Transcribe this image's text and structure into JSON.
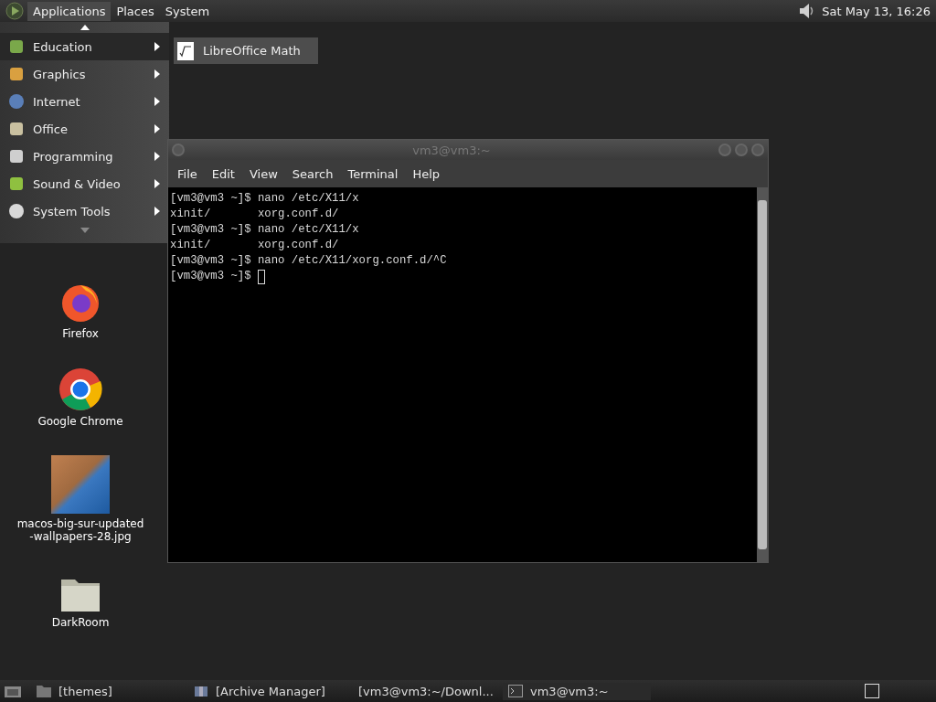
{
  "top_panel": {
    "menus": [
      {
        "label": "Applications",
        "selected": true
      },
      {
        "label": "Places",
        "selected": false
      },
      {
        "label": "System",
        "selected": false
      }
    ],
    "clock": "Sat May 13, 16:26"
  },
  "applications_menu": {
    "items": [
      {
        "label": "Education",
        "selected": true,
        "kind": "education"
      },
      {
        "label": "Graphics",
        "selected": false,
        "kind": "graphics"
      },
      {
        "label": "Internet",
        "selected": false,
        "kind": "internet"
      },
      {
        "label": "Office",
        "selected": false,
        "kind": "office"
      },
      {
        "label": "Programming",
        "selected": false,
        "kind": "programming"
      },
      {
        "label": "Sound & Video",
        "selected": false,
        "kind": "sound"
      },
      {
        "label": "System Tools",
        "selected": false,
        "kind": "system"
      }
    ],
    "submenu": [
      {
        "label": "LibreOffice Math",
        "selected": false
      }
    ]
  },
  "desktop_icons": [
    {
      "label": "Firefox",
      "kind": "firefox"
    },
    {
      "label": "Google Chrome",
      "kind": "chrome"
    },
    {
      "label": "macos-big-sur-updated-wallpapers-28.jpg",
      "kind": "image"
    },
    {
      "label": "DarkRoom",
      "kind": "folder"
    }
  ],
  "terminal": {
    "title": "vm3@vm3:~",
    "menu": [
      "File",
      "Edit",
      "View",
      "Search",
      "Terminal",
      "Help"
    ],
    "lines": [
      "[vm3@vm3 ~]$ nano /etc/X11/x",
      "xinit/       xorg.conf.d/",
      "[vm3@vm3 ~]$ nano /etc/X11/x",
      "xinit/       xorg.conf.d/",
      "[vm3@vm3 ~]$ nano /etc/X11/xorg.conf.d/^C"
    ],
    "prompt": "[vm3@vm3 ~]$ "
  },
  "taskbar": {
    "items": [
      {
        "label": "[themes]",
        "kind": "folder",
        "selected": false
      },
      {
        "label": "[Archive Manager]",
        "kind": "archive",
        "selected": false
      },
      {
        "label": "[vm3@vm3:~/Downl...",
        "kind": "terminal",
        "selected": false
      },
      {
        "label": "vm3@vm3:~",
        "kind": "terminal",
        "selected": true
      }
    ]
  }
}
